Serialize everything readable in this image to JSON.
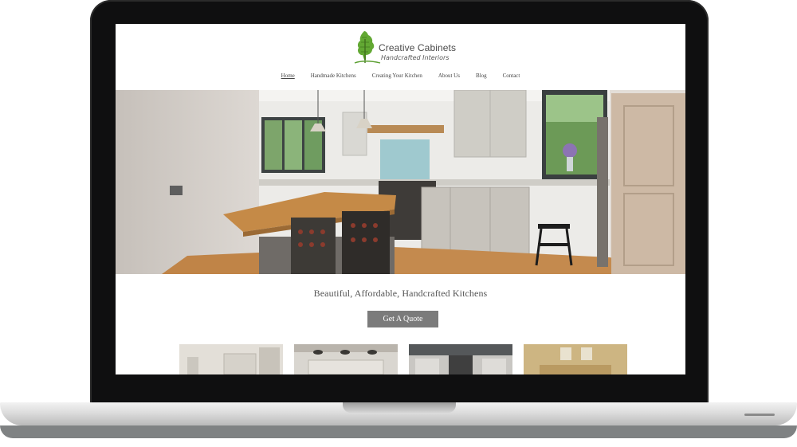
{
  "site": {
    "logo": {
      "title": "Creative Cabinets",
      "subtitle": "Handcrafted Interiors",
      "icon": "tree-icon",
      "brand_color": "#5a9e2f"
    },
    "nav": {
      "items": [
        {
          "label": "Home",
          "active": true
        },
        {
          "label": "Handmade Kitchens",
          "active": false
        },
        {
          "label": "Creating Your Kitchen",
          "active": false
        },
        {
          "label": "About Us",
          "active": false
        },
        {
          "label": "Blog",
          "active": false
        },
        {
          "label": "Contact",
          "active": false
        }
      ]
    },
    "hero": {
      "image": "kitchen-hero-photo"
    },
    "tagline": "Beautiful, Affordable, Handcrafted Kitchens",
    "cta": {
      "label": "Get A Quote",
      "color": "#7b7b7b"
    },
    "thumbnails": [
      {
        "image": "kitchen-thumbnail-1"
      },
      {
        "image": "kitchen-thumbnail-2"
      },
      {
        "image": "kitchen-thumbnail-3"
      },
      {
        "image": "kitchen-thumbnail-4"
      }
    ]
  }
}
